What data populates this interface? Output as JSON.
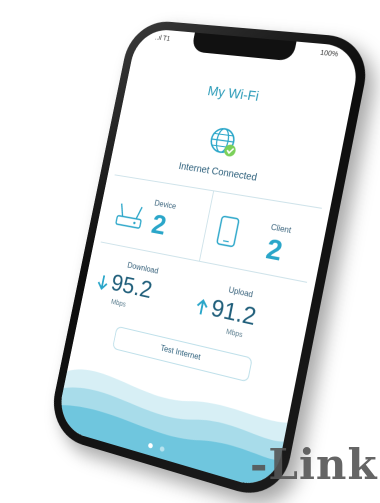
{
  "status": {
    "signal": "..ıl T1",
    "battery": "100%"
  },
  "app": {
    "title": "My Wi-Fi",
    "connection_status": "Internet Connected"
  },
  "device": {
    "label": "Device",
    "count": "2"
  },
  "client": {
    "label": "Client",
    "count": "2"
  },
  "download": {
    "label": "Download",
    "value": "95.2",
    "unit": "Mbps"
  },
  "upload": {
    "label": "Upload",
    "value": "91.2",
    "unit": "Mbps"
  },
  "test_button": {
    "label": "Test Internet"
  },
  "pager": {
    "active_index": 0,
    "count": 3
  },
  "brand": {
    "text": "-Link"
  },
  "colors": {
    "accent": "#2aa6c9",
    "text_dark": "#2a5e7a",
    "check": "#7bd05a"
  },
  "icons": [
    "globe-icon",
    "check-icon",
    "router-icon",
    "tablet-icon",
    "arrow-down-icon",
    "arrow-up-icon"
  ]
}
